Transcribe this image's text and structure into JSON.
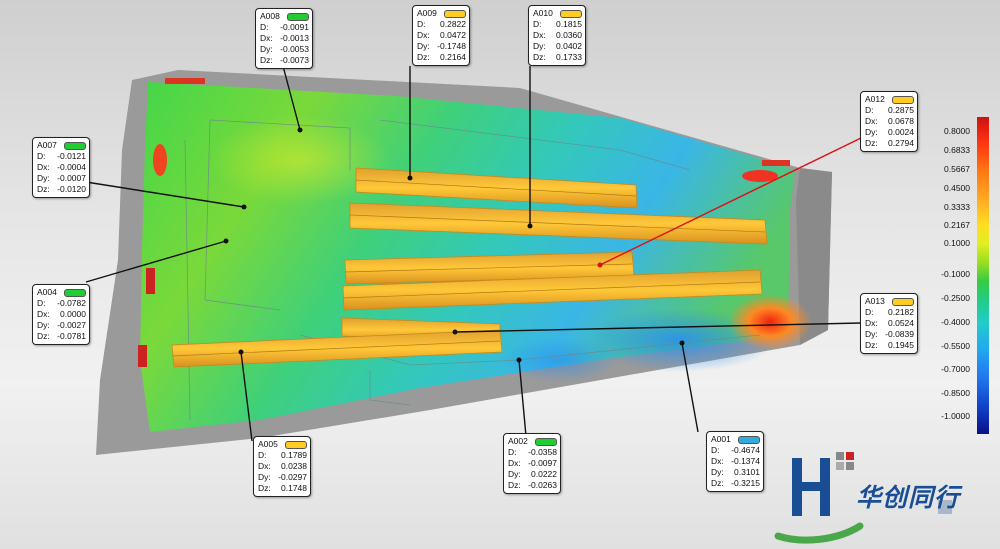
{
  "callouts": [
    {
      "id": "A008",
      "D": "-0.0091",
      "Dx": "-0.0013",
      "Dy": "-0.0053",
      "Dz": "-0.0073",
      "color": "#22cc33"
    },
    {
      "id": "A009",
      "D": "0.2822",
      "Dx": "0.0472",
      "Dy": "-0.1748",
      "Dz": "0.2164",
      "color": "#ffcc22"
    },
    {
      "id": "A010",
      "D": "0.1815",
      "Dx": "0.0360",
      "Dy": "0.0402",
      "Dz": "0.1733",
      "color": "#ffcc22"
    },
    {
      "id": "A012",
      "D": "0.2875",
      "Dx": "0.0678",
      "Dy": "0.0024",
      "Dz": "0.2794",
      "color": "#ffcc22"
    },
    {
      "id": "A007",
      "D": "-0.0121",
      "Dx": "-0.0004",
      "Dy": "-0.0007",
      "Dz": "-0.0120",
      "color": "#22cc33"
    },
    {
      "id": "A004",
      "D": "-0.0782",
      "Dx": "0.0000",
      "Dy": "-0.0027",
      "Dz": "-0.0781",
      "color": "#22cc33"
    },
    {
      "id": "A013",
      "D": "0.2182",
      "Dx": "0.0524",
      "Dy": "-0.0839",
      "Dz": "0.1945",
      "color": "#ffcc22"
    },
    {
      "id": "A005",
      "D": "0.1789",
      "Dx": "0.0238",
      "Dy": "-0.0297",
      "Dz": "0.1748",
      "color": "#ffcc22"
    },
    {
      "id": "A002",
      "D": "-0.0358",
      "Dx": "-0.0097",
      "Dy": "0.0222",
      "Dz": "-0.0263",
      "color": "#22cc33"
    },
    {
      "id": "A001",
      "D": "-0.4674",
      "Dx": "-0.1374",
      "Dy": "0.3101",
      "Dz": "-0.3215",
      "color": "#33aadd"
    }
  ],
  "labels": {
    "D": "D:",
    "Dx": "Dx:",
    "Dy": "Dy:",
    "Dz": "Dz:"
  },
  "legend": {
    "ticks": [
      "0.8000",
      "0.6833",
      "0.5667",
      "0.4500",
      "0.3333",
      "0.2167",
      "0.1000",
      "-0.1000",
      "-0.2500",
      "-0.4000",
      "-0.5500",
      "-0.7000",
      "-0.8500",
      "-1.0000"
    ],
    "colors": [
      "#cc1111",
      "#ee3311",
      "#ff6611",
      "#ff9922",
      "#ffcc22",
      "#ffee33",
      "#ddee22",
      "#55dd33",
      "#22cc66",
      "#22ccbb",
      "#22aaee",
      "#2277ee",
      "#1144cc",
      "#0a1a99"
    ]
  },
  "logo": {
    "text": "华创同行"
  }
}
